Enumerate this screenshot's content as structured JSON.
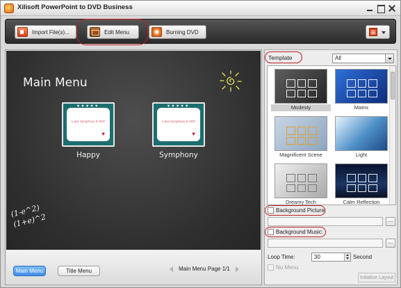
{
  "window": {
    "title": "Xilisoft PowerPoint to DVD Business",
    "app_icon": "xilisoft-app-icon",
    "controls": [
      "minimize-icon",
      "maximize-icon",
      "close-icon"
    ]
  },
  "toolbar": {
    "import_label": "Import File(s)...",
    "edit_menu_label": "Edit Menu",
    "burn_label": "Burning DVD",
    "menu_icon": "menu-icon",
    "highlight_color": "#c11e1e"
  },
  "preview": {
    "menu_title": "Main Menu",
    "items": [
      {
        "label": "Happy",
        "card_text": "Lotus Symphony & ODF"
      },
      {
        "label": "Symphony",
        "card_text": "Lotus Symphony & ODF"
      }
    ],
    "formula_lines": [
      "(1-e^2)",
      "(1+e)^2"
    ],
    "decor_icon": "sun-doodle-icon"
  },
  "bottom_bar": {
    "main_menu_label": "Main Menu",
    "title_menu_label": "Title Menu",
    "page_label": "Main Menu Page 1/1",
    "accent_color": "#3f8de8"
  },
  "right_panel": {
    "template_label": "Template",
    "filter_value": "All",
    "templates": [
      {
        "name": "Modesty",
        "selected": true
      },
      {
        "name": "Matrix"
      },
      {
        "name": "Magnificent Scene"
      },
      {
        "name": "Light"
      },
      {
        "name": "Dreamy Tech"
      },
      {
        "name": "Calm Reflection"
      }
    ],
    "background_picture_label": "Background Picture:",
    "background_music_label": "Background Music:",
    "browse_label": "...",
    "loop_time_label": "Loop Time:",
    "loop_time_value": "30",
    "loop_time_unit": "Second",
    "no_menu_label": "No Menu",
    "initialize_label": "Initialize Layout"
  }
}
